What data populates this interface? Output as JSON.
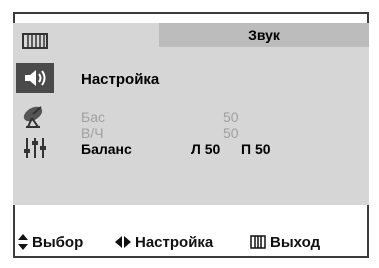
{
  "menu": {
    "title": "Звук",
    "subtitle": "Настройка",
    "icons": [
      {
        "name": "picture-menu-icon"
      },
      {
        "name": "sound-menu-icon",
        "active": true
      },
      {
        "name": "channel-antenna-icon"
      },
      {
        "name": "setup-equalizer-icon"
      }
    ],
    "rows": [
      {
        "label": "Бас",
        "value": "50",
        "active": false
      },
      {
        "label": "В/Ч",
        "value": "50",
        "active": false
      },
      {
        "label": "Баланс",
        "value": "Л 50",
        "value2": "П 50",
        "active": true
      }
    ]
  },
  "footer": {
    "select_label": "Выбор",
    "adjust_label": "Настройка",
    "exit_label": "Выход"
  },
  "colors": {
    "panel": "#d6d6d6",
    "title_bar": "#bcbcbc",
    "active_icon_bg": "#4a4a4a",
    "inactive_text": "#a0a0a0"
  }
}
